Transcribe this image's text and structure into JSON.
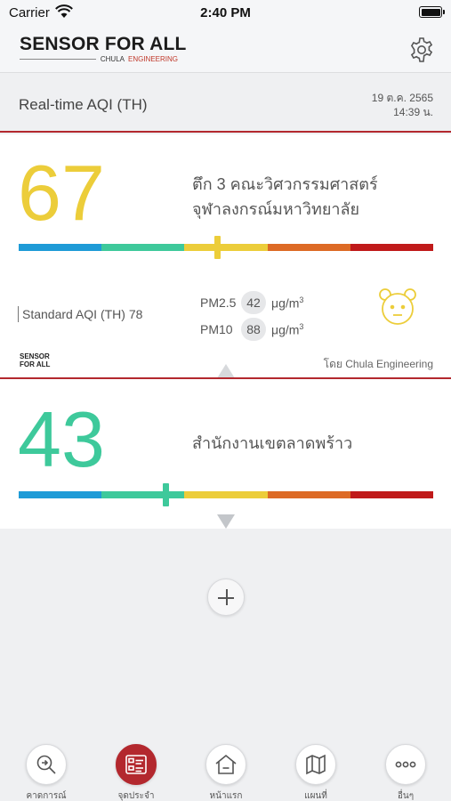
{
  "status_bar": {
    "carrier": "Carrier",
    "time": "2:40 PM"
  },
  "header": {
    "logo_main": "SENSOR FOR ALL",
    "logo_sub_chula": "CHULA",
    "logo_sub_eng": "ENGINEERING",
    "settings_icon": "gear-icon"
  },
  "subheader": {
    "title": "Real-time AQI (TH)",
    "date": "19 ต.ค. 2565",
    "time": "14:39 น."
  },
  "stations": [
    {
      "aqi": "67",
      "aqi_color": "#eccd3a",
      "name_line1": "ตึก 3 คณะวิศวกรรมศาสตร์",
      "name_line2": "จุฬาลงกรณ์มหาวิทยาลัย",
      "marker_position": 0.48,
      "marker_color": "#eccd3a",
      "standard_aqi": "Standard AQI (TH) 78",
      "pm25_label": "PM2.5",
      "pm25_value": "42",
      "pm10_label": "PM10",
      "pm10_value": "88",
      "unit": "μg/m",
      "unit_sup": "3",
      "mini_logo_line1": "SENSOR",
      "mini_logo_line2": "FOR ALL",
      "by_text": "โดย  Chula Engineering",
      "face_icon": "bear-face-icon"
    },
    {
      "aqi": "43",
      "aqi_color": "#3ec99b",
      "name_line1": "สำนักงานเขตลาดพร้าว",
      "marker_position": 0.355,
      "marker_color": "#3ec99b"
    }
  ],
  "scale_colors": [
    "#1e9bd7",
    "#3ec99b",
    "#eccd3a",
    "#dd6a25",
    "#c01a1a"
  ],
  "add_button_icon": "plus-icon",
  "tabs": [
    {
      "label": "คาดการณ์",
      "icon": "forecast-search-icon",
      "active": false
    },
    {
      "label": "จุดประจำ",
      "icon": "list-icon",
      "active": true
    },
    {
      "label": "หน้าแรก",
      "icon": "home-icon",
      "active": false
    },
    {
      "label": "แผนที่",
      "icon": "map-icon",
      "active": false
    },
    {
      "label": "อื่นๆ",
      "icon": "more-icon",
      "active": false
    }
  ]
}
